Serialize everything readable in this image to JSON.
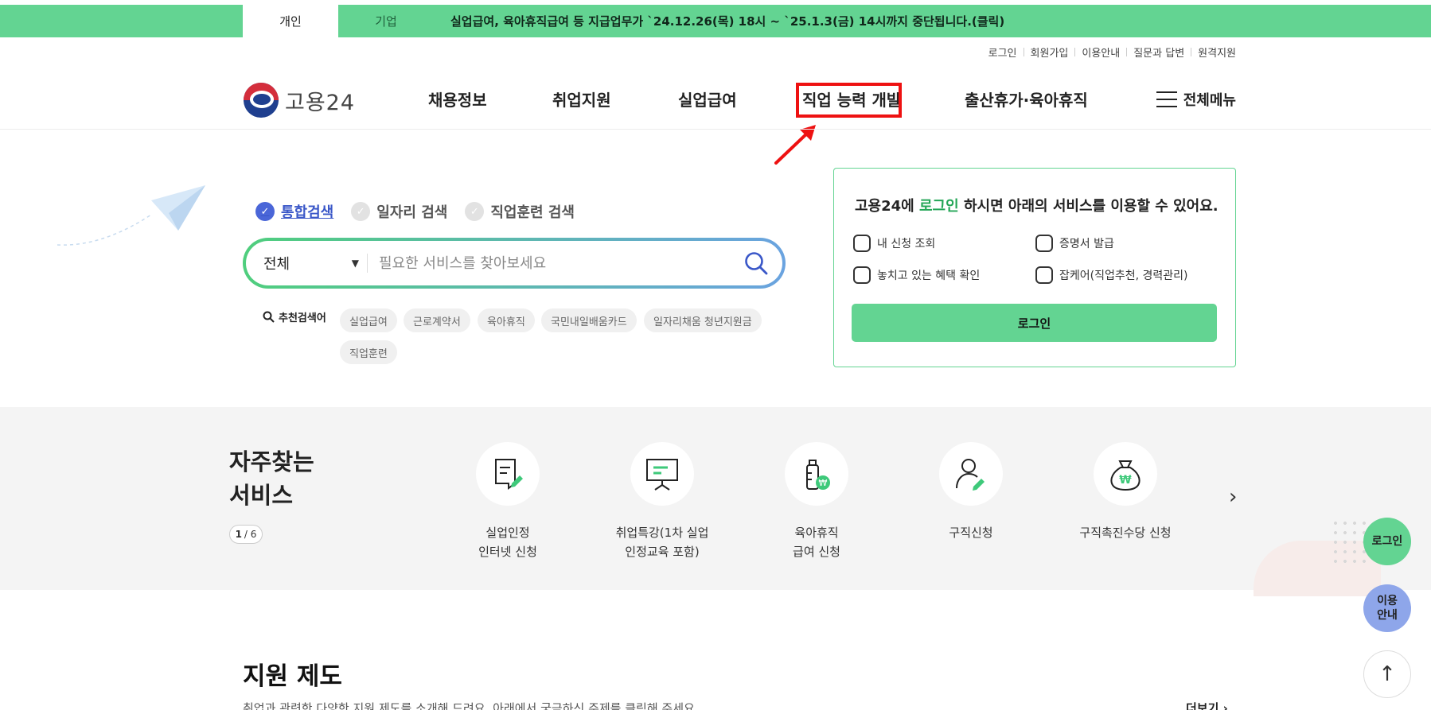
{
  "topbar": {
    "tabs": [
      {
        "label": "개인",
        "active": true
      },
      {
        "label": "기업",
        "active": false
      }
    ],
    "notice": "실업급여, 육아휴직급여 등 지급업무가 `24.12.26(목) 18시 ~ `25.1.3(금) 14시까지 중단됩니다.(클릭)"
  },
  "util_links": [
    "로그인",
    "회원가입",
    "이용안내",
    "질문과 답변",
    "원격지원"
  ],
  "logo": {
    "text": "고용24"
  },
  "gnb": [
    "채용정보",
    "취업지원",
    "실업급여",
    "직업 능력 개발",
    "출산휴가·육아휴직"
  ],
  "all_menu": "전체메뉴",
  "search": {
    "tabs": [
      {
        "label": "통합검색",
        "active": true
      },
      {
        "label": "일자리 검색",
        "active": false
      },
      {
        "label": "직업훈련 검색",
        "active": false
      }
    ],
    "scope": "전체",
    "placeholder": "필요한 서비스를 찾아보세요",
    "recommended_label": "추천검색어",
    "recommended": [
      "실업급여",
      "근로계약서",
      "육아휴직",
      "국민내일배움카드",
      "일자리채움 청년지원금",
      "직업훈련"
    ]
  },
  "login_card": {
    "title_prefix": "고용24에 ",
    "title_highlight": "로그인",
    "title_suffix": " 하시면 아래의 서비스를 이용할 수 있어요.",
    "items": [
      "내 신청 조회",
      "증명서 발급",
      "놓치고 있는 혜택 확인",
      "잡케어(직업추천, 경력관리)"
    ],
    "button": "로그인"
  },
  "frequent": {
    "title_line1": "자주찾는",
    "title_line2": "서비스",
    "page_current": "1",
    "page_total": "/ 6",
    "services": [
      {
        "line1": "실업인정",
        "line2": "인터넷 신청",
        "icon": "document-pen-icon"
      },
      {
        "line1": "취업특강(1차 실업",
        "line2": "인정교육 포함)",
        "icon": "presentation-board-icon"
      },
      {
        "line1": "육아휴직",
        "line2": "급여 신청",
        "icon": "baby-bottle-won-icon"
      },
      {
        "line1": "구직신청",
        "line2": "",
        "icon": "person-pen-icon"
      },
      {
        "line1": "구직촉진수당 신청",
        "line2": "",
        "icon": "money-bag-icon"
      }
    ]
  },
  "floating": {
    "login": "로그인",
    "guide_line1": "이용",
    "guide_line2": "안내"
  },
  "support": {
    "title": "지원 제도",
    "desc": "취업과 관련한 다양한 지원 제도를 소개해 드려요. 아래에서 궁금하신 주제를 클릭해 주세요.",
    "more": "더보기 ›"
  },
  "colors": {
    "brand_green": "#63d492",
    "accent_blue": "#4a66d8",
    "highlight_red": "#ee1111"
  }
}
